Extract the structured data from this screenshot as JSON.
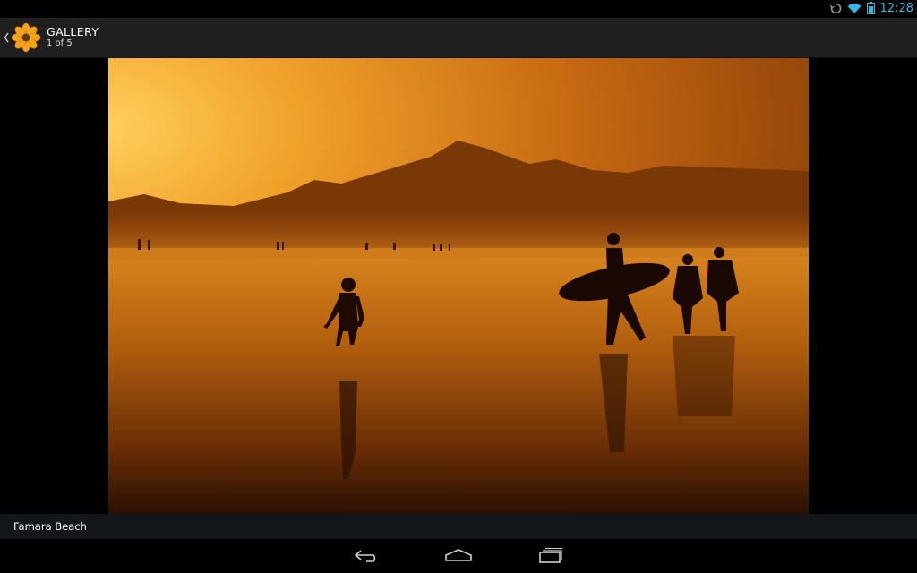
{
  "status_bar": {
    "time": "12:28",
    "icons": [
      "sync-icon",
      "wifi-icon",
      "battery-icon"
    ]
  },
  "action_bar": {
    "title": "GALLERY",
    "subtitle": "1 of 5",
    "icon": "gallery-flower-icon",
    "up_icon": "chevron-left-icon"
  },
  "photo": {
    "caption": "Famara Beach"
  },
  "nav_bar": {
    "buttons": [
      "back-icon",
      "home-icon",
      "recent-apps-icon"
    ]
  },
  "colors": {
    "accent": "#33b5e5",
    "action_bar_bg": "#1f1f1f",
    "caption_bg": "#13171b",
    "flower": "#f7a21b"
  }
}
